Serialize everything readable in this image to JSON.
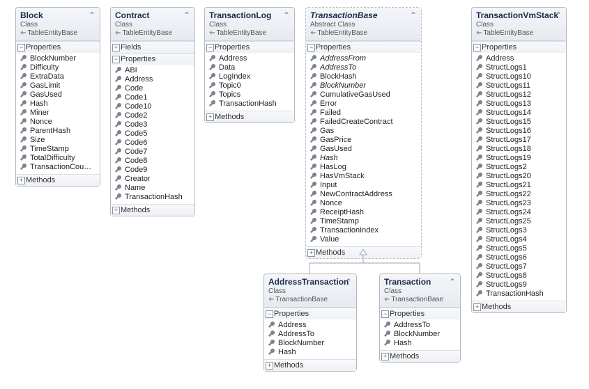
{
  "labels": {
    "class": "Class",
    "abstract": "Abstract Class",
    "base_table": "TableEntityBase",
    "base_tx": "TransactionBase",
    "properties": "Properties",
    "fields": "Fields",
    "methods": "Methods"
  },
  "boxes": {
    "block": {
      "title": "Block",
      "base": "TableEntityBase",
      "sections": [
        {
          "kind": "properties",
          "open": true,
          "items": [
            "BlockNumber",
            "Difficulty",
            "ExtraData",
            "GasLimit",
            "GasUsed",
            "Hash",
            "Miner",
            "Nonce",
            "ParentHash",
            "Size",
            "TimeStamp",
            "TotalDifficulty",
            "TransactionCou…"
          ]
        },
        {
          "kind": "methods",
          "open": false
        }
      ]
    },
    "contract": {
      "title": "Contract",
      "base": "TableEntityBase",
      "sections": [
        {
          "kind": "fields",
          "open": false
        },
        {
          "kind": "properties",
          "open": true,
          "items": [
            "ABI",
            "Address",
            "Code",
            "Code1",
            "Code10",
            "Code2",
            "Code3",
            "Code5",
            "Code6",
            "Code7",
            "Code8",
            "Code9",
            "Creator",
            "Name",
            "TransactionHash"
          ]
        },
        {
          "kind": "methods",
          "open": false
        }
      ]
    },
    "txlog": {
      "title": "TransactionLog",
      "base": "TableEntityBase",
      "sections": [
        {
          "kind": "properties",
          "open": true,
          "items": [
            "Address",
            "Data",
            "LogIndex",
            "Topic0",
            "Topics",
            "TransactionHash"
          ]
        },
        {
          "kind": "methods",
          "open": false
        }
      ]
    },
    "txbase": {
      "title": "TransactionBase",
      "base": "TableEntityBase",
      "abstract": true,
      "sections": [
        {
          "kind": "properties",
          "open": true,
          "items": [
            {
              "t": "AddressFrom",
              "i": true
            },
            {
              "t": "AddressTo",
              "i": true
            },
            "BlockHash",
            {
              "t": "BlockNumber",
              "i": true
            },
            "CumulativeGasUsed",
            "Error",
            "Failed",
            "FailedCreateContract",
            "Gas",
            "GasPrice",
            "GasUsed",
            {
              "t": "Hash",
              "i": true
            },
            "HasLog",
            "HasVmStack",
            "Input",
            "NewContractAddress",
            "Nonce",
            "ReceiptHash",
            "TimeStamp",
            "TransactionIndex",
            "Value"
          ]
        },
        {
          "kind": "methods",
          "open": false
        }
      ]
    },
    "txvm": {
      "title": "TransactionVmStack",
      "base": "TableEntityBase",
      "sections": [
        {
          "kind": "properties",
          "open": true,
          "items": [
            "Address",
            "StructLogs1",
            "StructLogs10",
            "StructLogs11",
            "StructLogs12",
            "StructLogs13",
            "StructLogs14",
            "StructLogs15",
            "StructLogs16",
            "StructLogs17",
            "StructLogs18",
            "StructLogs19",
            "StructLogs2",
            "StructLogs20",
            "StructLogs21",
            "StructLogs22",
            "StructLogs23",
            "StructLogs24",
            "StructLogs25",
            "StructLogs3",
            "StructLogs4",
            "StructLogs5",
            "StructLogs6",
            "StructLogs7",
            "StructLogs8",
            "StructLogs9",
            "TransactionHash"
          ]
        },
        {
          "kind": "methods",
          "open": false
        }
      ]
    },
    "addrtx": {
      "title": "AddressTransaction",
      "base": "TransactionBase",
      "sections": [
        {
          "kind": "properties",
          "open": true,
          "items": [
            "Address",
            "AddressTo",
            "BlockNumber",
            "Hash"
          ]
        },
        {
          "kind": "methods",
          "open": false
        }
      ]
    },
    "tx": {
      "title": "Transaction",
      "base": "TransactionBase",
      "sections": [
        {
          "kind": "properties",
          "open": true,
          "items": [
            "AddressTo",
            "BlockNumber",
            "Hash"
          ]
        },
        {
          "kind": "methods",
          "open": false
        }
      ]
    }
  }
}
